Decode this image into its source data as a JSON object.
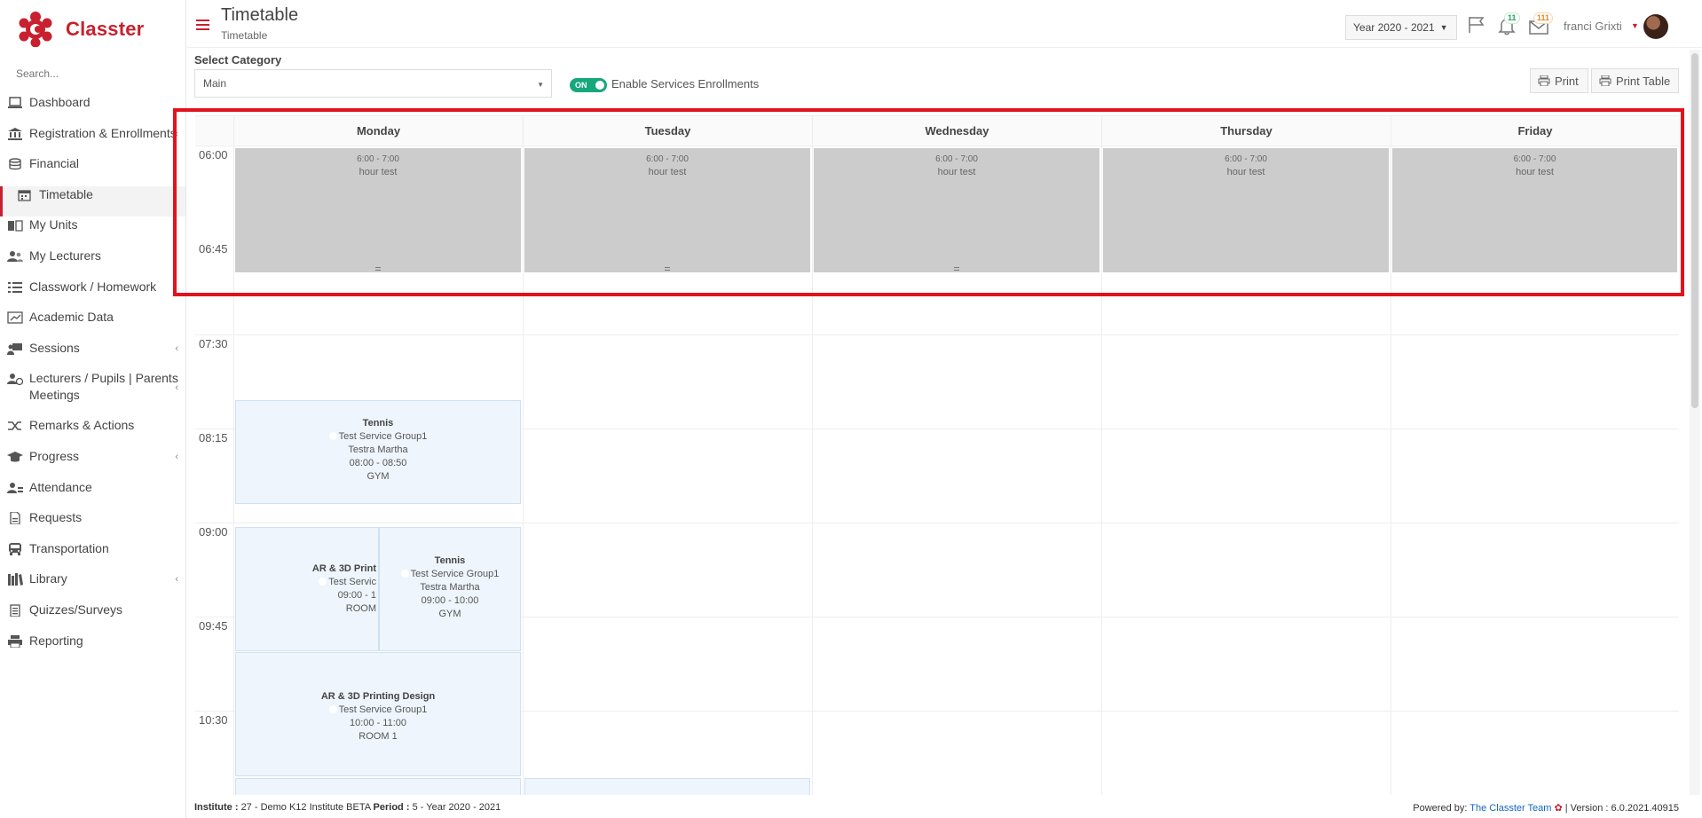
{
  "brand": {
    "name": "Classter"
  },
  "search": {
    "placeholder": "Search..."
  },
  "sidebar": {
    "items": [
      {
        "label": "Dashboard",
        "icon": "laptop-icon"
      },
      {
        "label": "Registration & Enrollments",
        "icon": "institution-icon"
      },
      {
        "label": "Financial",
        "icon": "coins-icon"
      },
      {
        "label": "Timetable",
        "icon": "calendar-icon",
        "active": true
      },
      {
        "label": "My Units",
        "icon": "book-icon"
      },
      {
        "label": "My Lecturers",
        "icon": "users-icon"
      },
      {
        "label": "Classwork / Homework",
        "icon": "list-icon"
      },
      {
        "label": "Academic Data",
        "icon": "chart-icon"
      },
      {
        "label": "Sessions",
        "icon": "presentation-icon"
      },
      {
        "label": "Lecturers / Pupils | Parents Meetings",
        "icon": "user-clock-icon"
      },
      {
        "label": "Remarks & Actions",
        "icon": "random-icon"
      },
      {
        "label": "Progress",
        "icon": "graduation-cap-icon"
      },
      {
        "label": "Attendance",
        "icon": "user-check-icon"
      },
      {
        "label": "Requests",
        "icon": "file-icon"
      },
      {
        "label": "Transportation",
        "icon": "bus-icon"
      },
      {
        "label": "Library",
        "icon": "books-icon"
      },
      {
        "label": "Quizzes/Surveys",
        "icon": "clipboard-icon"
      },
      {
        "label": "Reporting",
        "icon": "printer-icon"
      }
    ]
  },
  "header": {
    "title": "Timetable",
    "subtitle": "Timetable",
    "year": "Year 2020 - 2021",
    "notifications_count": "11",
    "messages_count": "111",
    "user": "franci Grixti"
  },
  "category": {
    "label": "Select Category",
    "value": "Main",
    "toggle_state": "ON",
    "toggle_label": "Enable Services Enrollments",
    "print_label": "Print",
    "print_table_label": "Print Table"
  },
  "timetable": {
    "days": [
      "Monday",
      "Tuesday",
      "Wednesday",
      "Thursday",
      "Friday"
    ],
    "times": [
      "06:00",
      "06:45",
      "07:30",
      "08:15",
      "09:00",
      "09:45",
      "10:30"
    ],
    "blocked": {
      "time": "6:00 - 7:00",
      "name": "hour test"
    },
    "events": [
      {
        "title": "Tennis",
        "group": "Test Service Group1",
        "lecturer": "Testra Martha",
        "time": "08:00 - 08:50",
        "room": "GYM"
      },
      {
        "title": "AR & 3D Print",
        "group": "Test Servic",
        "time": "09:00 - 1",
        "room": "ROOM"
      },
      {
        "title": "Tennis",
        "group": "Test Service Group1",
        "lecturer": "Testra Martha",
        "time": "09:00 - 10:00",
        "room": "GYM"
      },
      {
        "title": "AR & 3D Printing Design",
        "group": "Test Service Group1",
        "time": "10:00 - 11:00",
        "room": "ROOM 1"
      }
    ]
  },
  "footer": {
    "institute_label": "Institute :",
    "institute": "27 - Demo K12 Institute BETA",
    "period_label": "Period :",
    "period": "5 - Year 2020 - 2021",
    "powered_label": "Powered by:",
    "powered_link": "The Classter Team",
    "version_label": "| Version :",
    "version": "6.0.2021.40915"
  }
}
